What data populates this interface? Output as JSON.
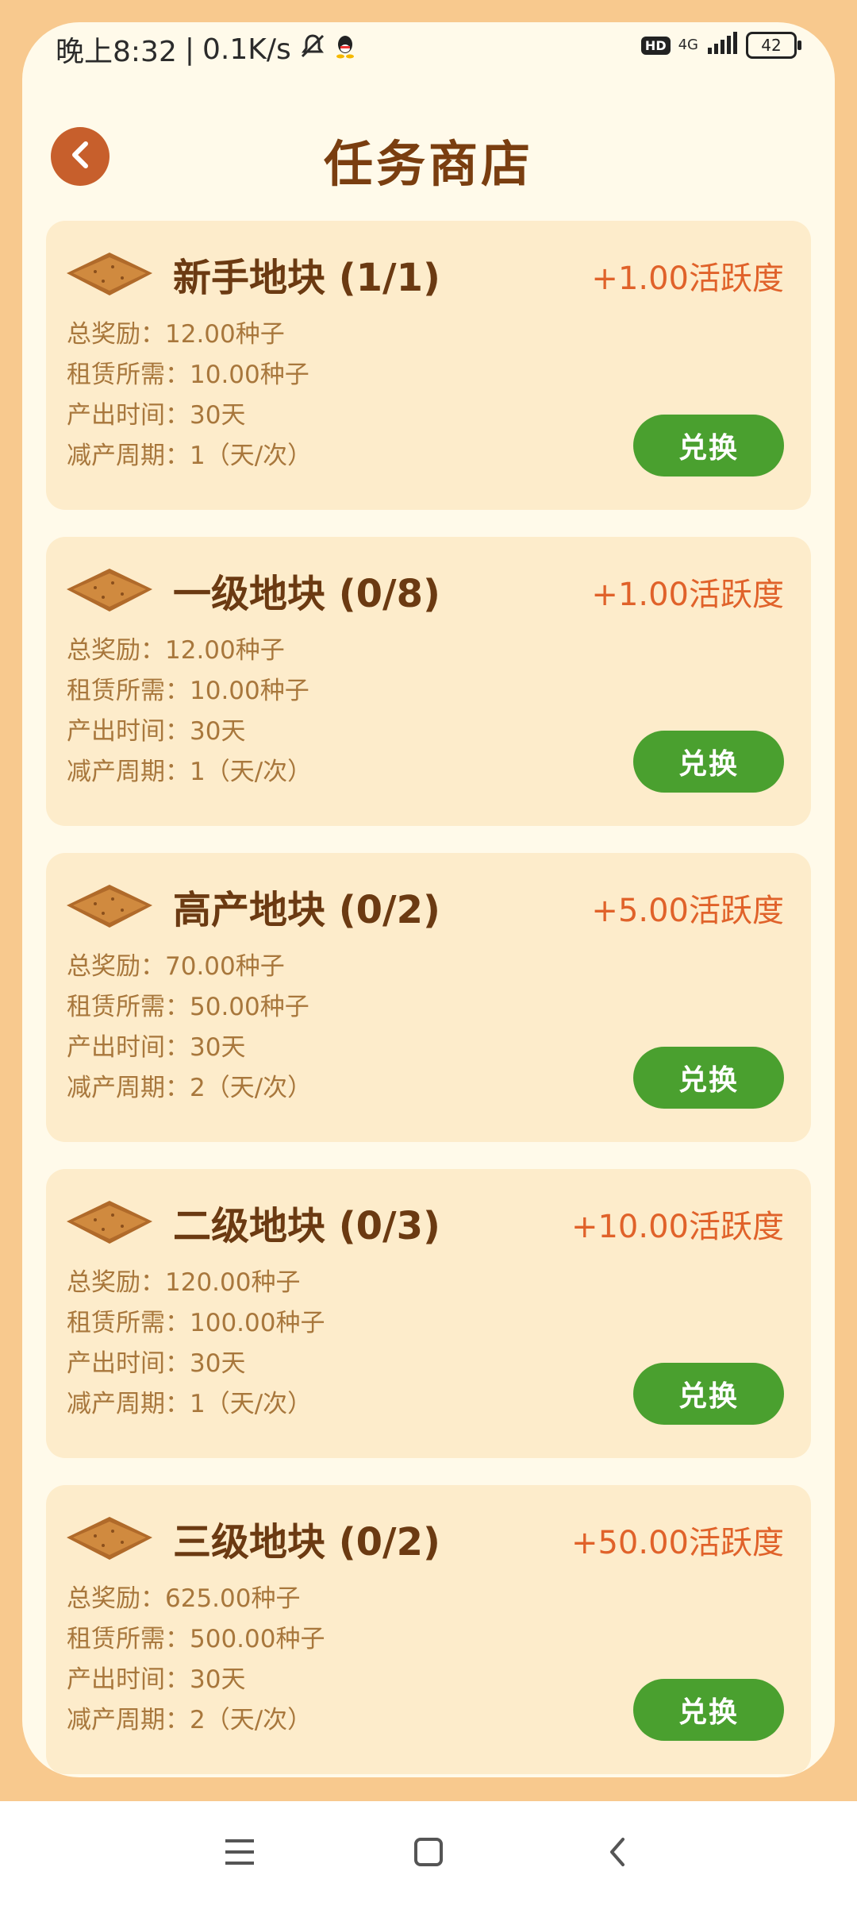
{
  "status_bar": {
    "time": "晚上8:32",
    "speed": "0.1K/s",
    "hd": "HD",
    "network": "4G",
    "battery": "42"
  },
  "header": {
    "title": "任务商店"
  },
  "labels": {
    "total_reward": "总奖励：",
    "rent_required": "租赁所需：",
    "output_time": "产出时间：",
    "reduction_cycle": "减产周期："
  },
  "cards": [
    {
      "title": "新手地块 (1/1)",
      "activity": "+1.00活跃度",
      "total_reward": "12.00种子",
      "rent_required": "10.00种子",
      "output_time": "30天",
      "reduction_cycle": "1（天/次）",
      "button": "兑换"
    },
    {
      "title": "一级地块 (0/8)",
      "activity": "+1.00活跃度",
      "total_reward": "12.00种子",
      "rent_required": "10.00种子",
      "output_time": "30天",
      "reduction_cycle": "1（天/次）",
      "button": "兑换"
    },
    {
      "title": "高产地块 (0/2)",
      "activity": "+5.00活跃度",
      "total_reward": "70.00种子",
      "rent_required": "50.00种子",
      "output_time": "30天",
      "reduction_cycle": "2（天/次）",
      "button": "兑换"
    },
    {
      "title": "二级地块 (0/3)",
      "activity": "+10.00活跃度",
      "total_reward": "120.00种子",
      "rent_required": "100.00种子",
      "output_time": "30天",
      "reduction_cycle": "1（天/次）",
      "button": "兑换"
    },
    {
      "title": "三级地块 (0/2)",
      "activity": "+50.00活跃度",
      "total_reward": "625.00种子",
      "rent_required": "500.00种子",
      "output_time": "30天",
      "reduction_cycle": "2（天/次）",
      "button": "兑换"
    }
  ],
  "colors": {
    "background": "#f8c98e",
    "panel": "#fffaea",
    "card": "#fdeccb",
    "title": "#7a3e10",
    "accent": "#e0622a",
    "button": "#4aa02f"
  },
  "icons": [
    "mute-icon",
    "qq-icon",
    "signal-icon",
    "back-icon",
    "soil-plot-icon",
    "menu-icon",
    "home-icon",
    "nav-back-icon"
  ]
}
